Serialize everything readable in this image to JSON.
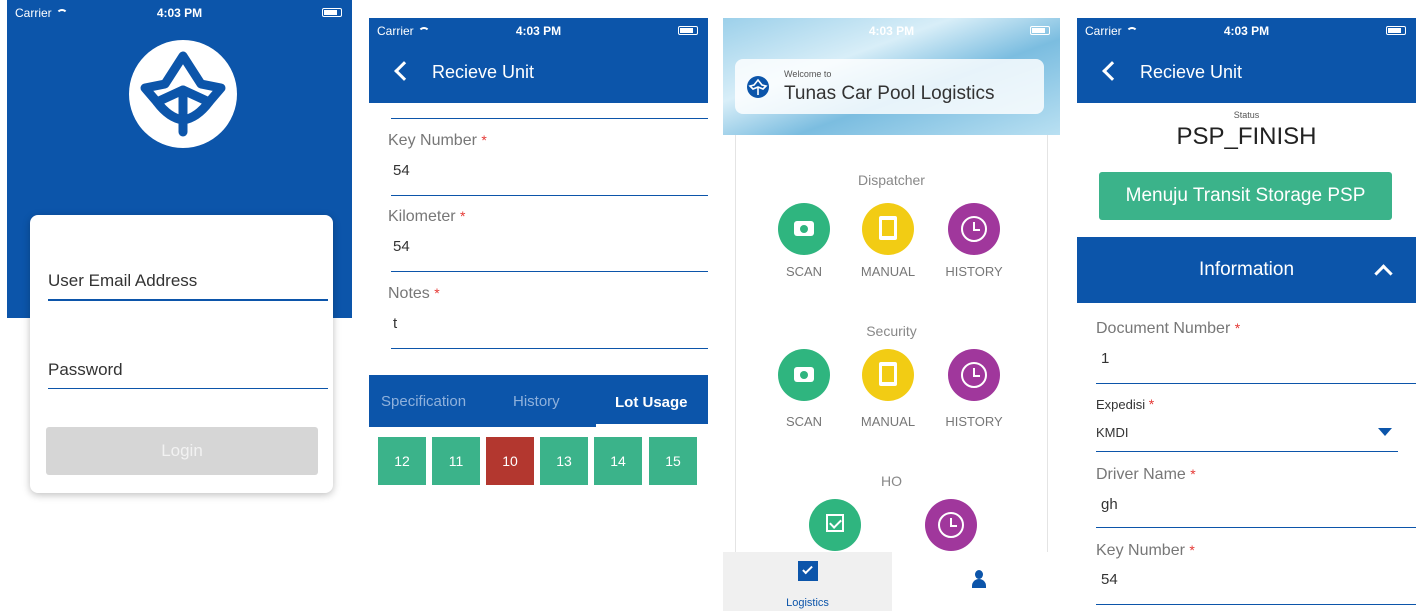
{
  "status_bar": {
    "carrier": "Carrier",
    "time": "4:03 PM"
  },
  "login": {
    "email_placeholder": "User Email Address",
    "password_placeholder": "Password",
    "login_label": "Login"
  },
  "receive_unit": {
    "title": "Recieve Unit",
    "fields": [
      {
        "label": "Key Number",
        "value": "54"
      },
      {
        "label": "Kilometer",
        "value": "54"
      },
      {
        "label": "Notes",
        "value": "t"
      }
    ],
    "tabs": [
      {
        "label": "Specification"
      },
      {
        "label": "History"
      },
      {
        "label": "Lot Usage"
      }
    ],
    "lots": [
      {
        "label": "12",
        "color": "#3bb38a"
      },
      {
        "label": "11",
        "color": "#3bb38a"
      },
      {
        "label": "10",
        "color": "#b3372f"
      },
      {
        "label": "13",
        "color": "#3bb38a"
      },
      {
        "label": "14",
        "color": "#3bb38a"
      },
      {
        "label": "15",
        "color": "#3bb38a"
      }
    ]
  },
  "dashboard": {
    "welcome": "Welcome to",
    "app_name": "Tunas Car Pool Logistics",
    "sections": [
      {
        "title": "Dispatcher",
        "actions": [
          "SCAN",
          "MANUAL",
          "HISTORY"
        ]
      },
      {
        "title": "Security",
        "actions": [
          "SCAN",
          "MANUAL",
          "HISTORY"
        ]
      },
      {
        "title": "HO"
      }
    ],
    "bottom_nav": {
      "logistics": "Logistics"
    }
  },
  "detail": {
    "title": "Recieve Unit",
    "status_label": "Status",
    "status_value": "PSP_FINISH",
    "action_label": "Menuju Transit Storage PSP",
    "section_title": "Information",
    "fields": [
      {
        "label": "Document Number",
        "value": "1"
      },
      {
        "label": "Expedisi",
        "value": "KMDI"
      },
      {
        "label": "Driver Name",
        "value": "gh"
      },
      {
        "label": "Key Number",
        "value": "54"
      }
    ]
  },
  "colors": {
    "primary_blue": "#0c55aa",
    "green": "#2fb57f",
    "yellow": "#f2cc14",
    "purple": "#a0379c",
    "red_lot": "#b3372f"
  }
}
